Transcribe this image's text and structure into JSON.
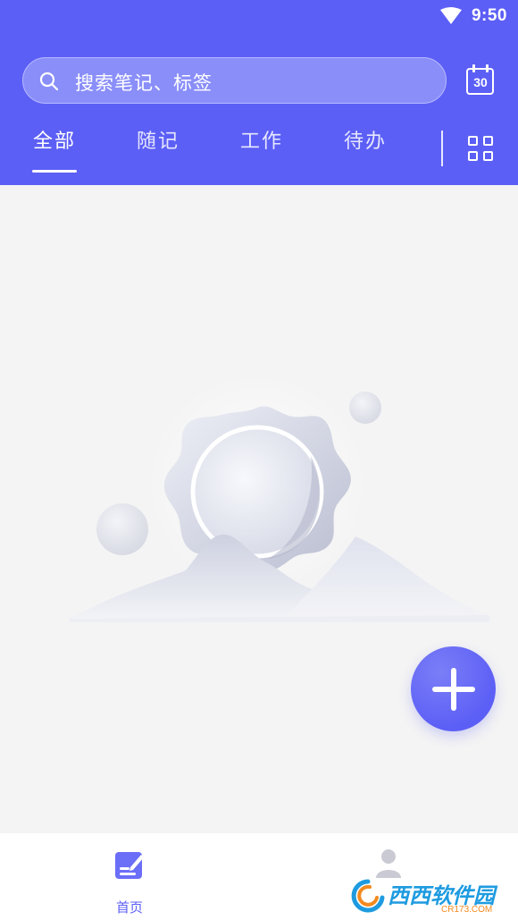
{
  "status_bar": {
    "time": "9:50",
    "icon": "wifi-icon"
  },
  "header": {
    "search": {
      "placeholder": "搜索笔记、标签",
      "icon": "search-icon"
    },
    "calendar": {
      "day": "30",
      "icon": "calendar-icon"
    },
    "tabs": [
      {
        "label": "全部",
        "active": true
      },
      {
        "label": "随记",
        "active": false
      },
      {
        "label": "工作",
        "active": false
      },
      {
        "label": "待办",
        "active": false
      }
    ],
    "grid_toggle_icon": "grid-view-icon"
  },
  "main": {
    "empty_illustration": "sun-mountains-illustration"
  },
  "fab": {
    "icon": "plus-icon"
  },
  "bottom_nav": {
    "items": [
      {
        "label": "首页",
        "icon": "note-edit-icon",
        "active": true
      },
      {
        "label": "",
        "icon": "person-icon",
        "active": false
      }
    ]
  },
  "watermark": {
    "text": "西西软件园",
    "sub": "CR173.COM"
  },
  "colors": {
    "primary": "#5c5ff5",
    "background": "#f4f4f4",
    "nav_bg": "#ffffff"
  }
}
